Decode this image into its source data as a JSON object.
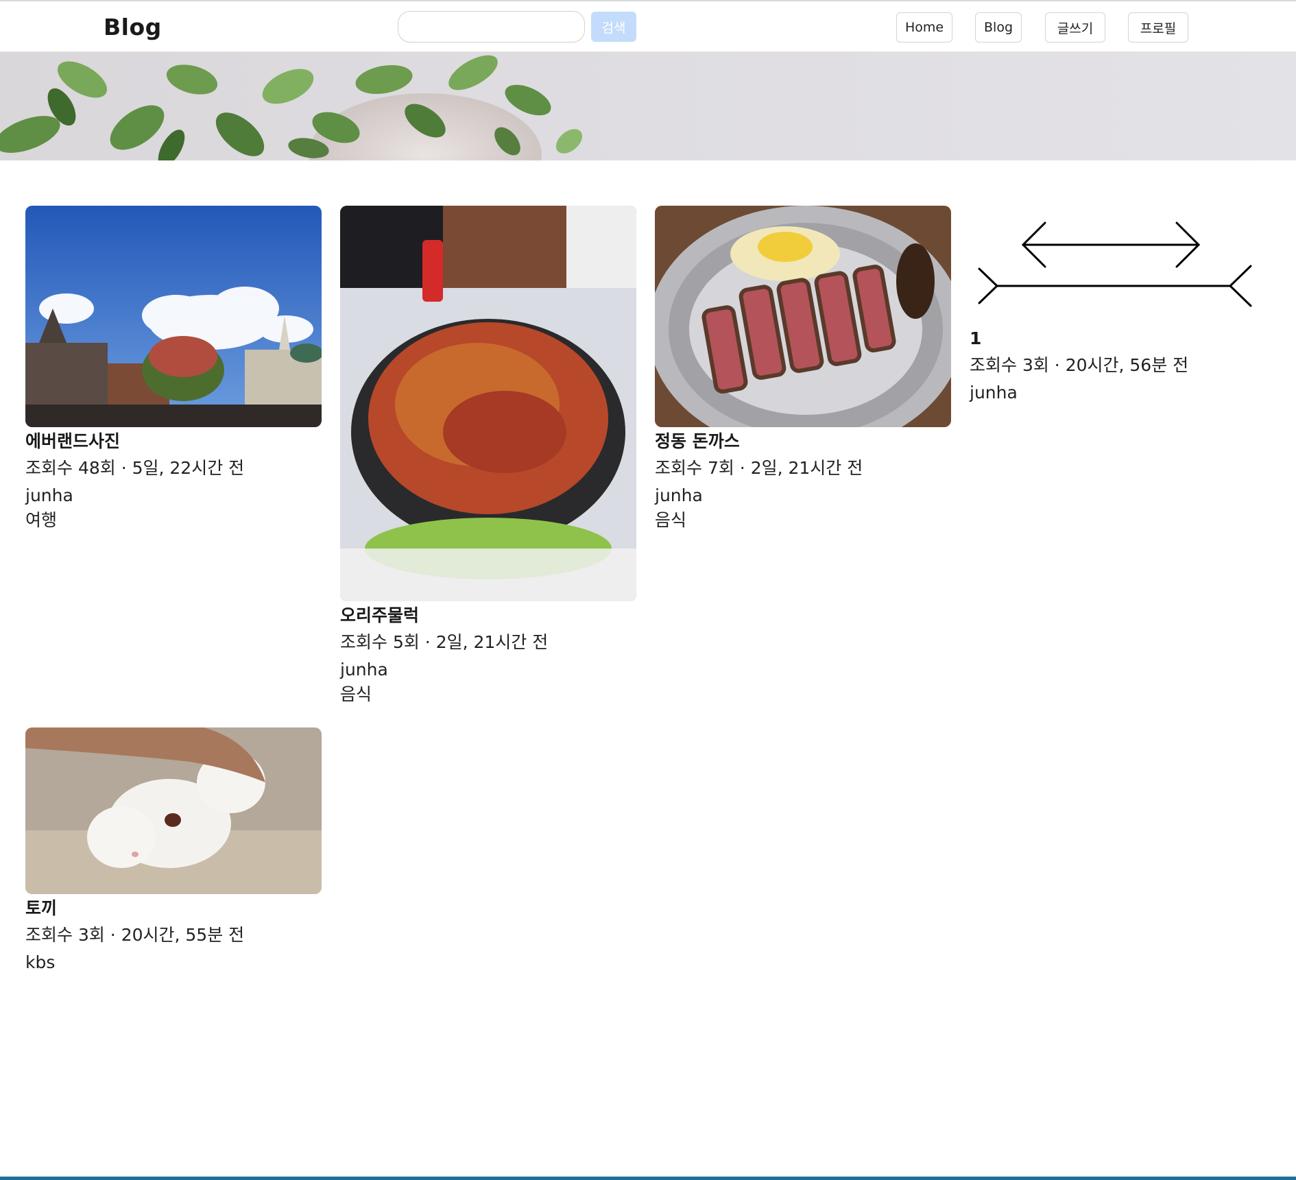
{
  "header": {
    "brand": "Blog",
    "search": {
      "value": "",
      "placeholder": "",
      "button_label": "검색"
    },
    "nav": [
      {
        "label": "Home"
      },
      {
        "label": "Blog"
      },
      {
        "label": "글쓰기"
      },
      {
        "label": "프로필"
      }
    ]
  },
  "posts": [
    {
      "title": "에버랜드사진",
      "views": "조회수 48회 · 5일, 22시간 전",
      "author": "junha",
      "category": "여행",
      "image": "amusement-park-photo"
    },
    {
      "title": "오리주물럭",
      "views": "조회수 5회 · 2일, 21시간 전",
      "author": "junha",
      "category": "음식",
      "image": "stir-fried-duck-photo"
    },
    {
      "title": "정동 돈까스",
      "views": "조회수 7회 · 2일, 21시간 전",
      "author": "junha",
      "category": "음식",
      "image": "pork-cutlet-photo"
    },
    {
      "title": "1",
      "views": "조회수 3회 · 20시간, 56분 전",
      "author": "junha",
      "category": "",
      "image": "arrow-illusion-diagram"
    },
    {
      "title": "토끼",
      "views": "조회수 3회 · 20시간, 55분 전",
      "author": "kbs",
      "category": "",
      "image": "white-rabbit-photo"
    }
  ],
  "colors": {
    "search_button": "#c3dcfb",
    "bottom_bar": "#1f6f99"
  }
}
